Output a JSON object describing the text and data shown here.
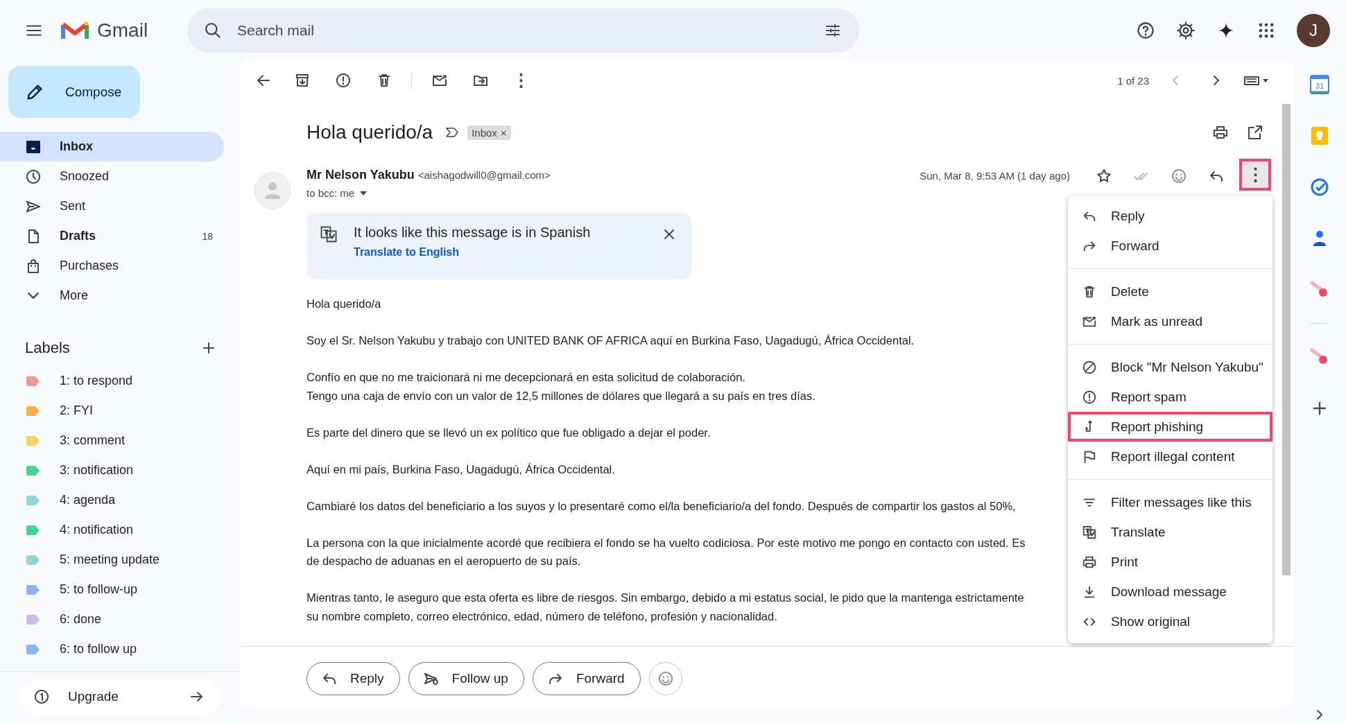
{
  "header": {
    "logo_text": "Gmail",
    "search": {
      "placeholder": "Search mail"
    },
    "avatar_letter": "J"
  },
  "sidebar": {
    "compose": "Compose",
    "nav": [
      {
        "kind": "inbox",
        "label": "Inbox",
        "selected": true,
        "unread": true
      },
      {
        "kind": "snoozed",
        "label": "Snoozed",
        "selected": false,
        "unread": false
      },
      {
        "kind": "sent",
        "label": "Sent",
        "selected": false,
        "unread": false
      },
      {
        "kind": "drafts",
        "label": "Drafts",
        "count": "18",
        "selected": false,
        "unread": true
      },
      {
        "kind": "purchases",
        "label": "Purchases",
        "selected": false,
        "unread": false
      },
      {
        "kind": "more",
        "label": "More",
        "selected": false,
        "unread": false
      }
    ],
    "labels_title": "Labels",
    "labels": [
      {
        "name": "1: to respond",
        "color": "#ee9a8d"
      },
      {
        "name": "2: FYI",
        "color": "#ffad47"
      },
      {
        "name": "3: comment",
        "color": "#fad165"
      },
      {
        "name": "3: notification",
        "color": "#42d692"
      },
      {
        "name": "4: agenda",
        "color": "#8fd6dc"
      },
      {
        "name": "4: notification",
        "color": "#42d692"
      },
      {
        "name": "5: meeting update",
        "color": "#8fd6dc"
      },
      {
        "name": "5: to follow-up",
        "color": "#8ab4f8"
      },
      {
        "name": "6: done",
        "color": "#cdb8f0"
      },
      {
        "name": "6: to follow up",
        "color": "#8ab4f8"
      }
    ],
    "upgrade": "Upgrade"
  },
  "toolbar": {
    "pagination": "1 of 23",
    "prev_disabled": true,
    "next_disabled": false
  },
  "message": {
    "subject": "Hola querido/a",
    "tag": "Inbox",
    "tag_remove": "×",
    "sender_name": "Mr Nelson Yakubu",
    "sender_email": "<aishagodwill0@gmail.com>",
    "recipients": "to bcc: me",
    "date": "Sun, Mar 8, 9:53 AM (1 day ago)",
    "more_highlighted": true,
    "translate_banner": {
      "text": "It looks like this message is in Spanish",
      "link": "Translate to English"
    },
    "body": [
      [
        "Hola querido/a"
      ],
      [
        "Soy el Sr. Nelson Yakubu y trabajo con UNITED BANK OF AFRICA aquí en Burkina Faso, Uagadugú, África Occidental."
      ],
      [
        "Confío en que no me traicionará ni me decepcionará en esta solicitud de colaboración.",
        "Tengo una caja de envío con un valor de 12,5 millones de dólares que llegará a su país en tres días."
      ],
      [
        "Es parte del dinero que se llevó un ex político que fue obligado a dejar el poder."
      ],
      [
        "Aquí en mi país, Burkina Faso, Uagadugú, África Occidental."
      ],
      [
        "Cambiaré los datos del beneficiario a los suyos y lo presentaré como el/la beneficiario/a del fondo. Después de compartir los gastos al 50%,"
      ],
      [
        "La persona con la que inicialmente acordé que recibiera el fondo se ha vuelto codiciosa. Por este motivo me pongo en contacto con usted. Es",
        "de despacho de aduanas en el aeropuerto de su país."
      ],
      [
        "Mientras tanto, le aseguro que esta oferta es libre de riesgos. Sin embargo, debido a mi estatus social, le pido que la mantenga estrictamente",
        "su nombre completo, correo electrónico, edad, número de teléfono, profesión y nacionalidad."
      ]
    ]
  },
  "menu": {
    "sections": [
      [
        {
          "kind": "reply",
          "label": "Reply",
          "highlighted": false
        },
        {
          "kind": "forward",
          "label": "Forward",
          "highlighted": false
        }
      ],
      [
        {
          "kind": "delete",
          "label": "Delete",
          "highlighted": false
        },
        {
          "kind": "unread",
          "label": "Mark as unread",
          "highlighted": false
        }
      ],
      [
        {
          "kind": "block",
          "label": "Block \"Mr Nelson Yakubu\"",
          "highlighted": false
        },
        {
          "kind": "spam",
          "label": "Report spam",
          "highlighted": false
        },
        {
          "kind": "phishing",
          "label": "Report phishing",
          "highlighted": true
        },
        {
          "kind": "flag",
          "label": "Report illegal content",
          "highlighted": false
        }
      ],
      [
        {
          "kind": "filter",
          "label": "Filter messages like this",
          "highlighted": false
        },
        {
          "kind": "translate",
          "label": "Translate",
          "highlighted": false
        },
        {
          "kind": "print",
          "label": "Print",
          "highlighted": false
        },
        {
          "kind": "download",
          "label": "Download message",
          "highlighted": false
        },
        {
          "kind": "code",
          "label": "Show original",
          "highlighted": false
        }
      ]
    ]
  },
  "reply_bar": {
    "buttons": [
      {
        "kind": "reply",
        "label": "Reply"
      },
      {
        "kind": "followup",
        "label": "Follow up"
      },
      {
        "kind": "forward",
        "label": "Forward"
      }
    ]
  },
  "rail": {
    "calendar_day": "31"
  }
}
